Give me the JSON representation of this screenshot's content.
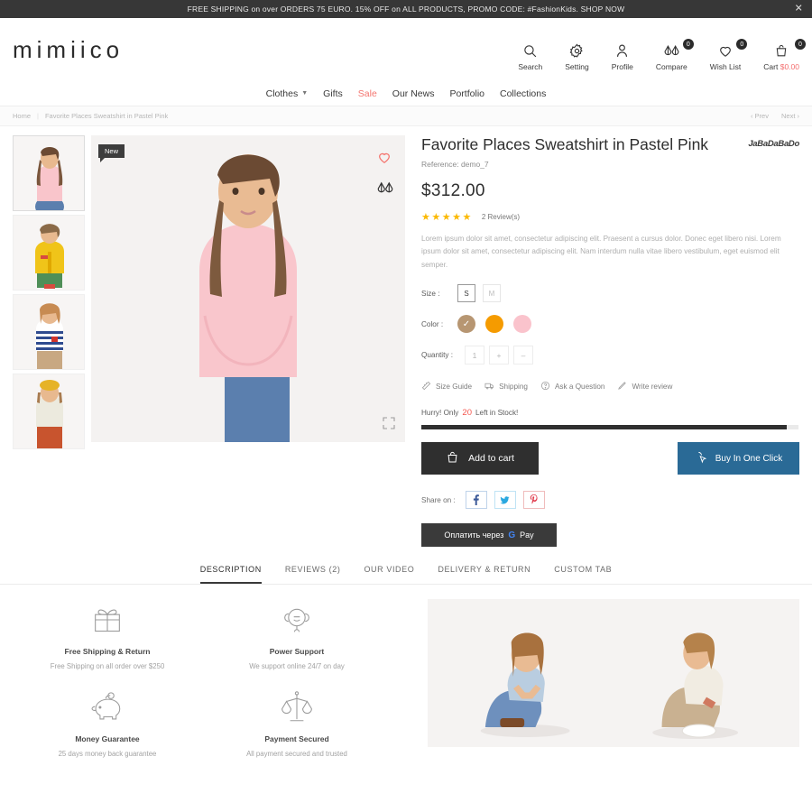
{
  "promo": {
    "text": "FREE SHIPPING on over ORDERS 75 EURO. 15% OFF on ALL PRODUCTS, PROMO CODE: #FashionKids. SHOP NOW",
    "close": "✕"
  },
  "header": {
    "logo": "mimiico",
    "tools": [
      {
        "label": "Search",
        "icon": "search-icon",
        "badge": null
      },
      {
        "label": "Setting",
        "icon": "gear-icon",
        "badge": null
      },
      {
        "label": "Profile",
        "icon": "user-icon",
        "badge": null
      },
      {
        "label": "Compare",
        "icon": "compare-icon",
        "badge": "0"
      },
      {
        "label": "Wish List",
        "icon": "heart-icon",
        "badge": "0"
      },
      {
        "label": "Cart",
        "amount": "$0.00",
        "icon": "bag-icon",
        "badge": "0"
      }
    ]
  },
  "nav": {
    "items": [
      {
        "label": "Clothes",
        "has_caret": true,
        "sale": false
      },
      {
        "label": "Gifts",
        "has_caret": false,
        "sale": false
      },
      {
        "label": "Sale",
        "has_caret": false,
        "sale": true
      },
      {
        "label": "Our News",
        "has_caret": false,
        "sale": false
      },
      {
        "label": "Portfolio",
        "has_caret": false,
        "sale": false
      },
      {
        "label": "Collections",
        "has_caret": false,
        "sale": false
      }
    ]
  },
  "breadcrumb": {
    "home": "Home",
    "current": "Favorite Places Sweatshirt in Pastel Pink",
    "prev": "‹  Prev",
    "next": "Next  ›"
  },
  "gallery": {
    "new_badge": "New",
    "thumbs": [
      {
        "name": "thumb-pastel-pink-sweatshirt"
      },
      {
        "name": "thumb-yellow-jacket"
      },
      {
        "name": "thumb-striped-tee"
      },
      {
        "name": "thumb-beret-outfit"
      }
    ]
  },
  "product": {
    "title": "Favorite Places Sweatshirt in Pastel Pink",
    "brand": "JaBaDaBaDo",
    "reference": "Reference: demo_7",
    "price": "$312.00",
    "stars": "★★★★★",
    "review_count": "2 Review(s)",
    "description": "Lorem ipsum dolor sit amet, consectetur adipiscing elit. Praesent a cursus dolor. Donec eget libero nisi. Lorem ipsum dolor sit amet, consectetur adipiscing elit. Nam interdum nulla vitae libero vestibulum, eget euismod elit semper.",
    "size_label": "Size :",
    "sizes": [
      {
        "label": "S",
        "selected": true
      },
      {
        "label": "M",
        "selected": false
      }
    ],
    "color_label": "Color :",
    "colors": [
      {
        "name": "brown",
        "hex": "#b79672",
        "selected": true
      },
      {
        "name": "orange",
        "hex": "#f59b00",
        "selected": false
      },
      {
        "name": "pink",
        "hex": "#fac3cc",
        "selected": false
      }
    ],
    "quantity_label": "Quantity :",
    "quantity_value": "1",
    "quantity_plus": "+",
    "quantity_minus": "–",
    "links": [
      {
        "label": "Size Guide",
        "icon": "ruler-icon"
      },
      {
        "label": "Shipping",
        "icon": "truck-icon"
      },
      {
        "label": "Ask a Question",
        "icon": "question-icon"
      },
      {
        "label": "Write review",
        "icon": "pencil-icon"
      }
    ],
    "stock_prefix": "Hurry! Only",
    "stock_count": "20",
    "stock_suffix": "Left in Stock!",
    "stock_percent": 97,
    "add_to_cart": "Add to cart",
    "buy_one_click": "Buy In One Click",
    "share_label": "Share on :",
    "share": [
      {
        "network": "facebook",
        "glyph": "f"
      },
      {
        "network": "twitter",
        "glyph": "✈"
      },
      {
        "network": "pinterest",
        "glyph": "P"
      }
    ],
    "gpay_text": "Оплатить через",
    "gpay_brand_g": "G",
    "gpay_brand_pay": "Pay"
  },
  "tabs": [
    {
      "label": "DESCRIPTION",
      "active": true
    },
    {
      "label": "REVIEWS (2)",
      "active": false
    },
    {
      "label": "OUR VIDEO",
      "active": false
    },
    {
      "label": "DELIVERY & RETURN",
      "active": false
    },
    {
      "label": "CUSTOM TAB",
      "active": false
    }
  ],
  "features": [
    {
      "icon": "gift-icon",
      "title": "Free Shipping & Return",
      "text": "Free Shipping on all order over $250"
    },
    {
      "icon": "headset-icon",
      "title": "Power Support",
      "text": "We support online 24/7 on day"
    },
    {
      "icon": "piggy-bank-icon",
      "title": "Money Guarantee",
      "text": "25 days money back guarantee"
    },
    {
      "icon": "scales-icon",
      "title": "Payment Secured",
      "text": "All payment secured and trusted"
    }
  ],
  "colors": {
    "accent_red": "#f4756f",
    "dark": "#2f2f2f",
    "blue": "#2a6a96",
    "star": "#fbb900"
  }
}
